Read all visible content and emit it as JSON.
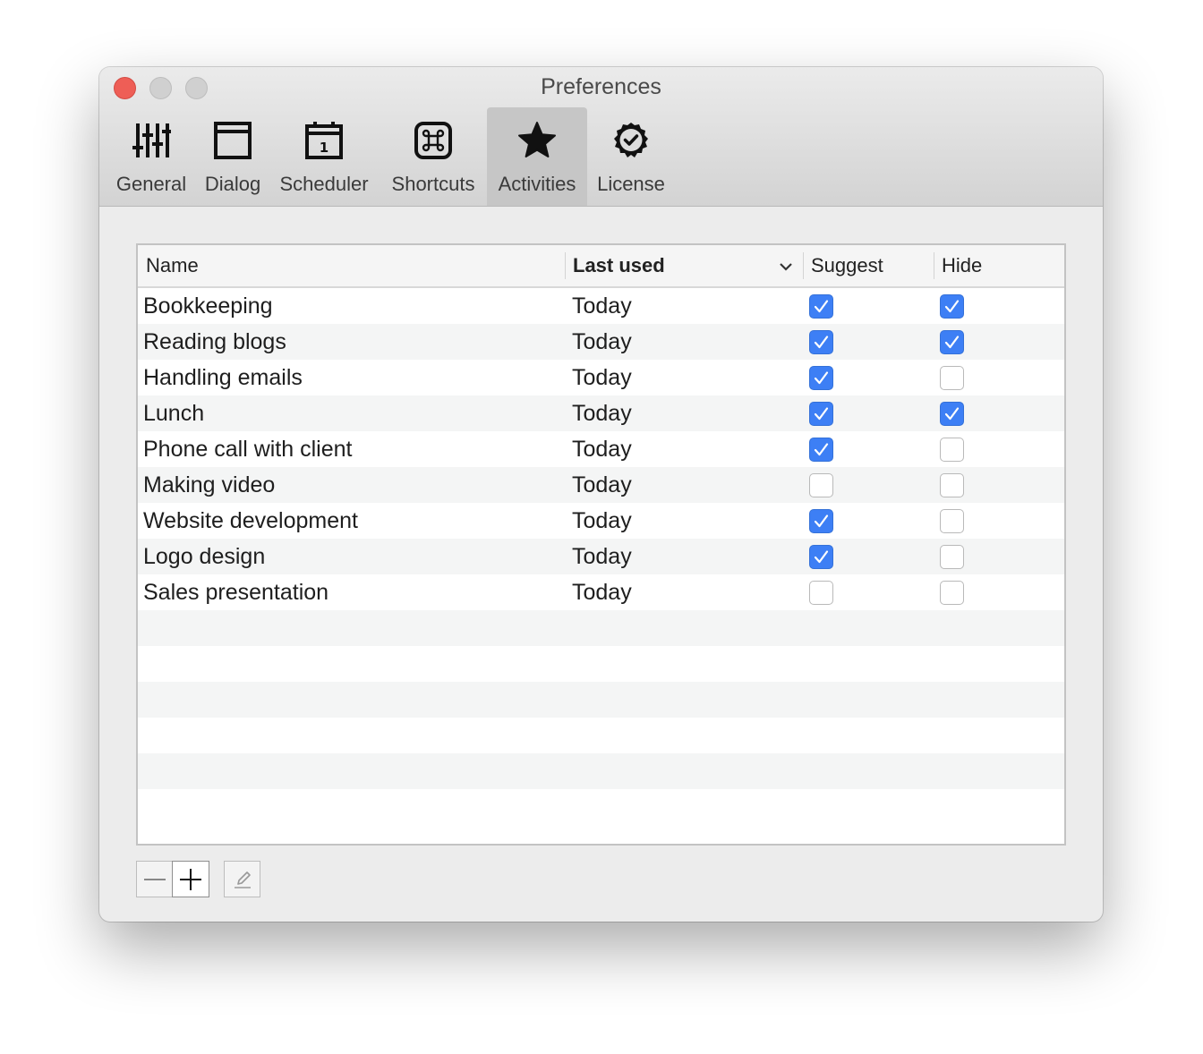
{
  "window": {
    "title": "Preferences"
  },
  "toolbar": {
    "items": [
      {
        "label": "General",
        "icon": "sliders-icon",
        "active": false
      },
      {
        "label": "Dialog",
        "icon": "window-icon",
        "active": false
      },
      {
        "label": "Scheduler",
        "icon": "calendar-icon",
        "active": false
      },
      {
        "label": "Shortcuts",
        "icon": "command-key-icon",
        "active": false
      },
      {
        "label": "Activities",
        "icon": "star-icon",
        "active": true
      },
      {
        "label": "License",
        "icon": "badge-check-icon",
        "active": false
      }
    ],
    "calendar_day": "1"
  },
  "table": {
    "columns": {
      "name": "Name",
      "last_used": "Last used",
      "suggest": "Suggest",
      "hide": "Hide"
    },
    "sort_indicator": "chevron-down-icon",
    "rows": [
      {
        "name": "Bookkeeping",
        "last_used": "Today",
        "suggest": true,
        "hide": true
      },
      {
        "name": "Reading blogs",
        "last_used": "Today",
        "suggest": true,
        "hide": true
      },
      {
        "name": "Handling emails",
        "last_used": "Today",
        "suggest": true,
        "hide": false
      },
      {
        "name": "Lunch",
        "last_used": "Today",
        "suggest": true,
        "hide": true
      },
      {
        "name": "Phone call with client",
        "last_used": "Today",
        "suggest": true,
        "hide": false
      },
      {
        "name": "Making video",
        "last_used": "Today",
        "suggest": false,
        "hide": false
      },
      {
        "name": "Website development",
        "last_used": "Today",
        "suggest": true,
        "hide": false
      },
      {
        "name": "Logo design",
        "last_used": "Today",
        "suggest": true,
        "hide": false
      },
      {
        "name": "Sales presentation",
        "last_used": "Today",
        "suggest": false,
        "hide": false
      }
    ]
  },
  "colors": {
    "checkbox_on": "#3d7ff5",
    "close_button": "#ee5e56"
  }
}
